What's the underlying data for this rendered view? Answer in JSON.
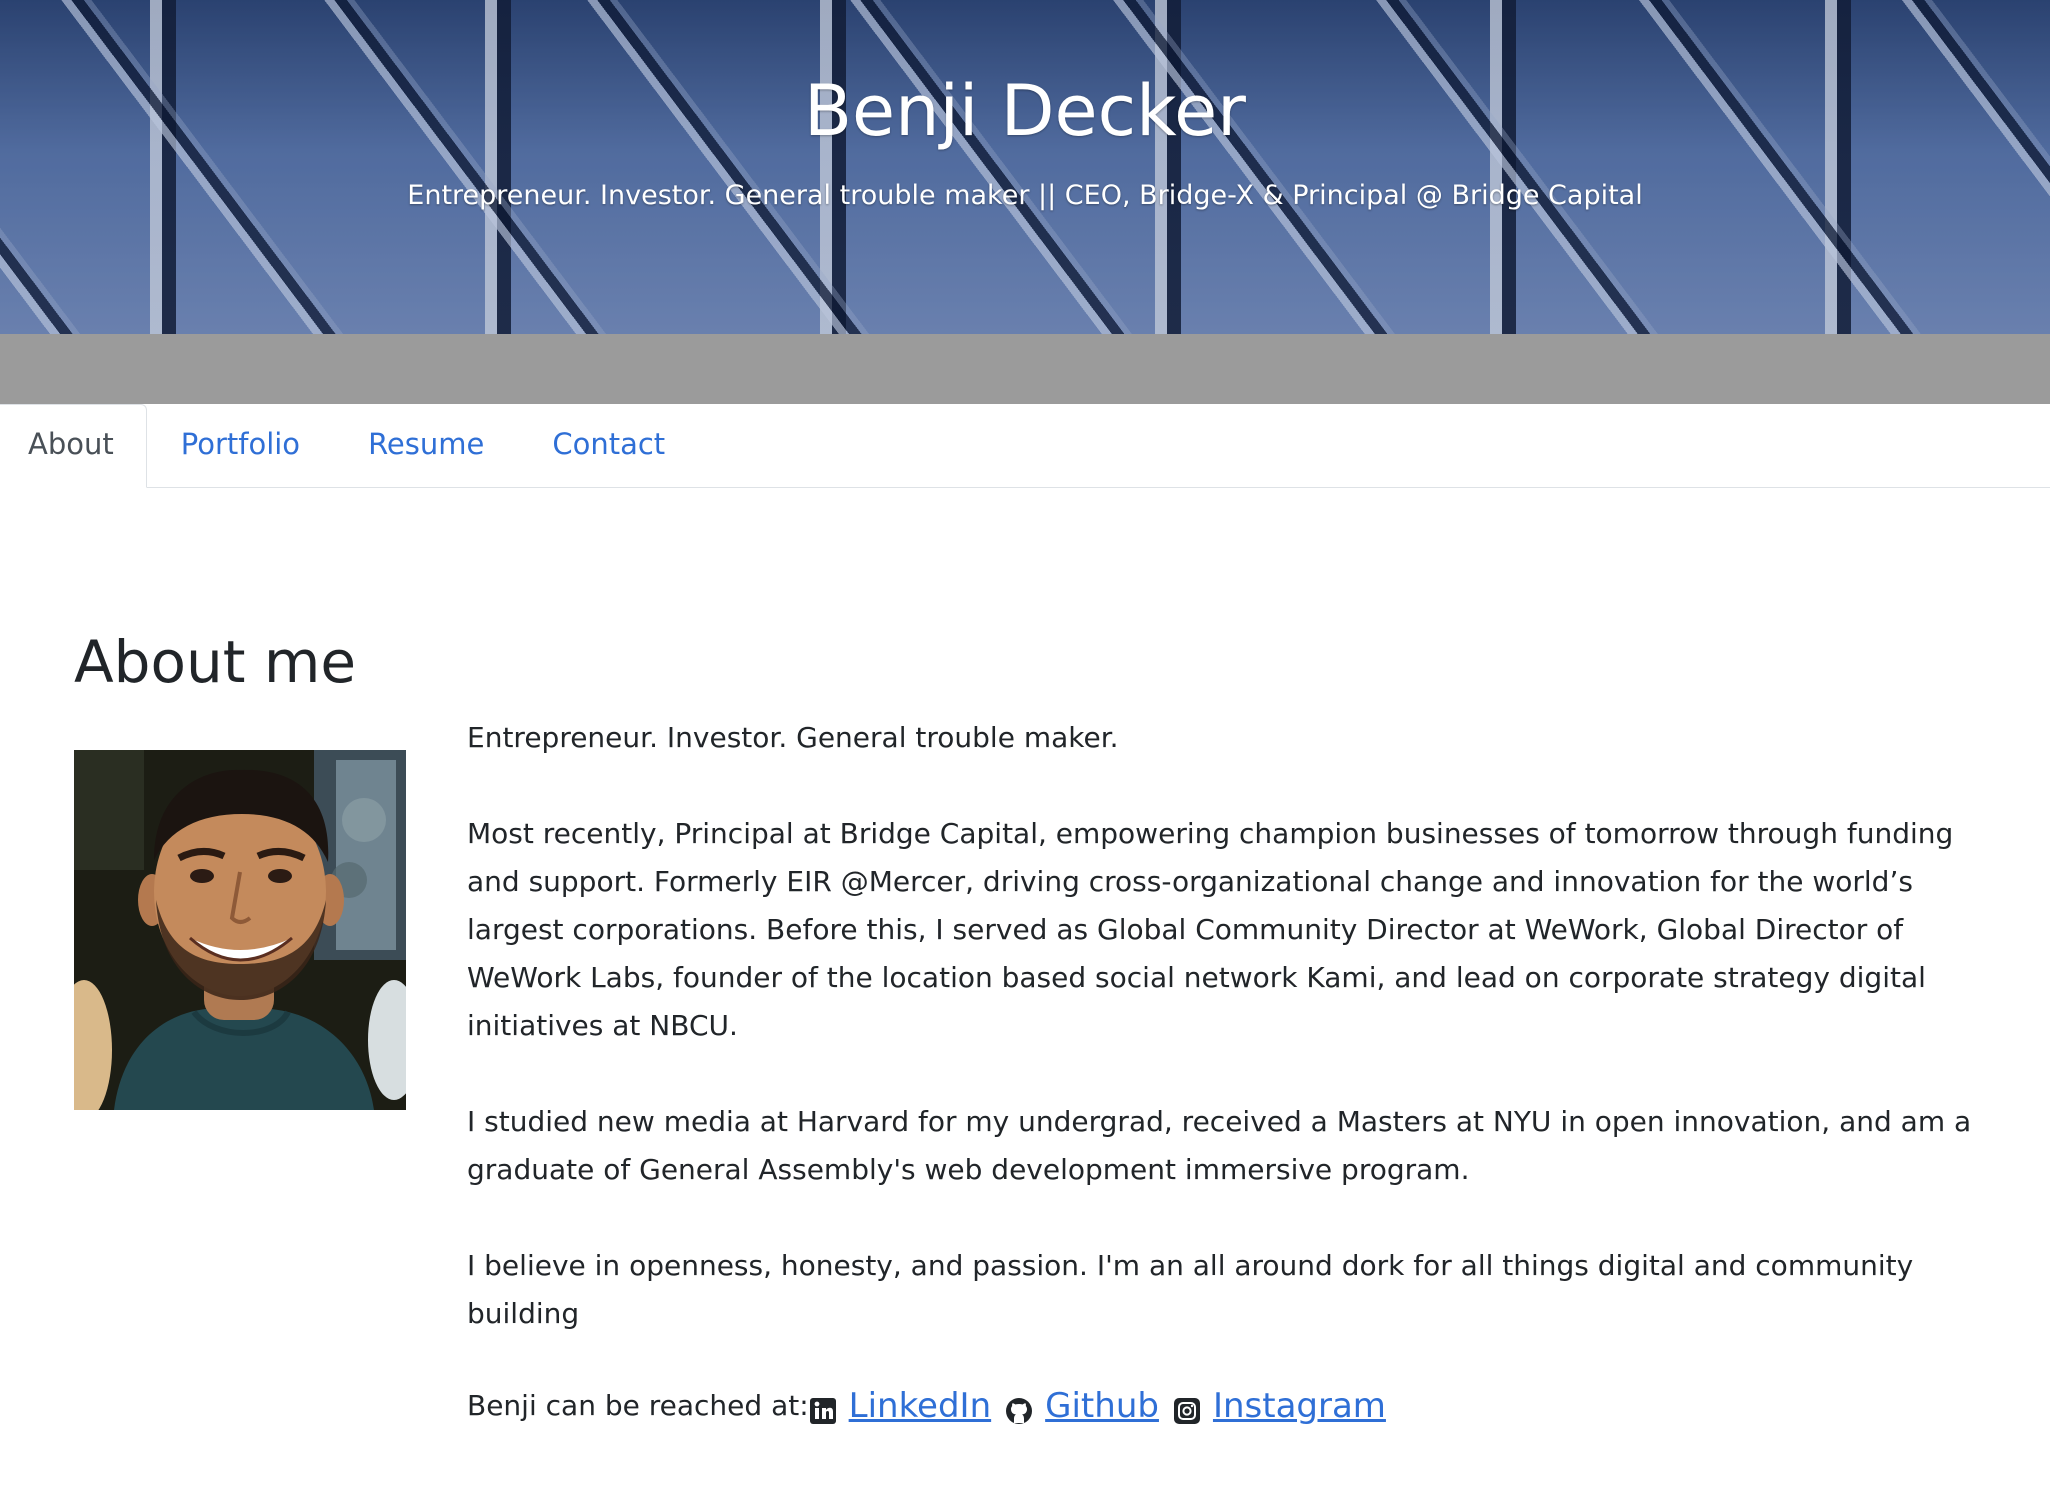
{
  "header": {
    "title": "Benji Decker",
    "subtitle": "Entrepreneur. Investor. General trouble maker || CEO, Bridge-X & Principal @ Bridge Capital"
  },
  "tabs": [
    {
      "label": "About",
      "active": true
    },
    {
      "label": "Portfolio",
      "active": false
    },
    {
      "label": "Resume",
      "active": false
    },
    {
      "label": "Contact",
      "active": false
    }
  ],
  "about": {
    "heading": "About me",
    "paragraphs": [
      "Entrepreneur. Investor. General trouble maker.",
      "Most recently, Principal at Bridge Capital, empowering champion businesses of tomorrow through funding and support. Formerly EIR @Mercer, driving cross-organizational change and innovation for the world’s largest corporations. Before this, I served as Global Community Director at WeWork, Global Director of WeWork Labs, founder of the location based social network Kami, and lead on corporate strategy digital initiatives at NBCU.",
      "I studied new media at Harvard for my undergrad, received a Masters at NYU in open innovation, and am a graduate of General Assembly's web development immersive program.",
      "I believe in openness, honesty, and passion. I'm an all around dork for all things digital and community building"
    ],
    "reach_label": "Benji can be reached at:",
    "links": [
      {
        "icon": "linkedin-icon",
        "label": "LinkedIn"
      },
      {
        "icon": "github-icon",
        "label": "Github"
      },
      {
        "icon": "instagram-icon",
        "label": "Instagram"
      }
    ]
  },
  "colors": {
    "link": "#2f6fd6",
    "gray_strip": "#9b9b9b",
    "text": "#212529"
  }
}
